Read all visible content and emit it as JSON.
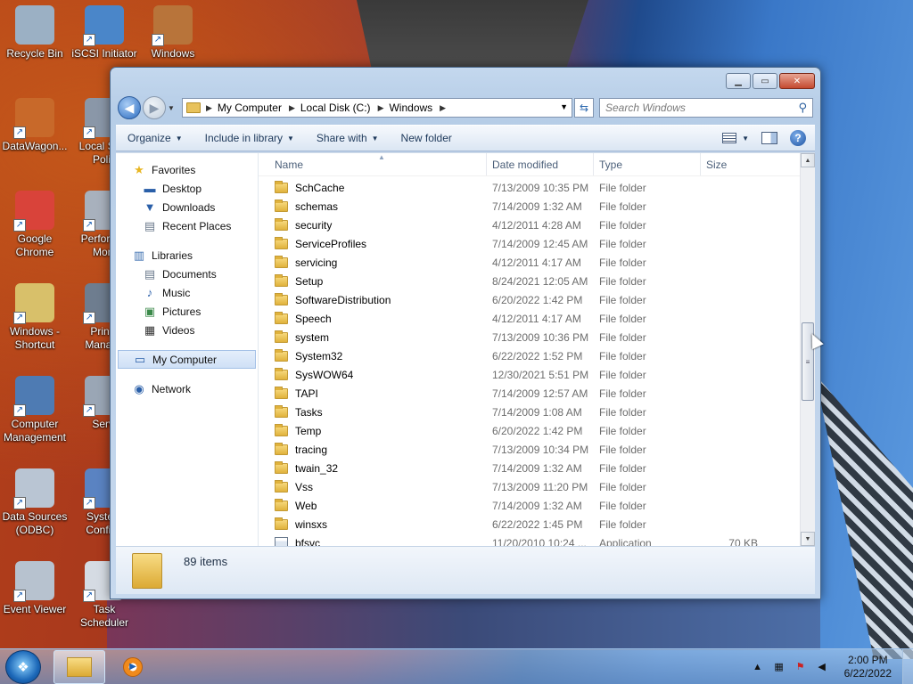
{
  "desktop": {
    "icons": [
      {
        "label": "Recycle Bin",
        "icon": "recycle-bin-icon"
      },
      {
        "label": "iSCSI Initiator",
        "icon": "iscsi-icon"
      },
      {
        "label": "Windows",
        "icon": "windows-icon"
      },
      {
        "label": "DataWagon...",
        "icon": "datawagon-icon"
      },
      {
        "label": "Local Se... Polic",
        "icon": "local-security-icon"
      },
      {
        "label": "Google Chrome",
        "icon": "chrome-icon"
      },
      {
        "label": "Perform... Moni",
        "icon": "performance-icon"
      },
      {
        "label": "Windows - Shortcut",
        "icon": "windows-shortcut-icon"
      },
      {
        "label": "Prin... Manage",
        "icon": "print-management-icon"
      },
      {
        "label": "Computer Management",
        "icon": "computer-management-icon"
      },
      {
        "label": "Servi",
        "icon": "services-icon"
      },
      {
        "label": "Data Sources (ODBC)",
        "icon": "odbc-icon"
      },
      {
        "label": "Syste... Configu",
        "icon": "system-config-icon"
      },
      {
        "label": "Event Viewer",
        "icon": "event-viewer-icon"
      },
      {
        "label": "Task Scheduler",
        "icon": "task-scheduler-icon"
      }
    ]
  },
  "window": {
    "address": {
      "segments": [
        "My Computer",
        "Local Disk (C:)",
        "Windows"
      ]
    },
    "search": {
      "placeholder": "Search Windows"
    },
    "toolbar": {
      "organize": "Organize",
      "include": "Include in library",
      "share": "Share with",
      "new_folder": "New folder"
    },
    "nav": {
      "favorites": "Favorites",
      "desktop": "Desktop",
      "downloads": "Downloads",
      "recent": "Recent Places",
      "libraries": "Libraries",
      "documents": "Documents",
      "music": "Music",
      "pictures": "Pictures",
      "videos": "Videos",
      "computer": "My Computer",
      "network": "Network"
    },
    "columns": {
      "name": "Name",
      "date": "Date modified",
      "type": "Type",
      "size": "Size"
    },
    "files": [
      {
        "name": "SchCache",
        "date": "7/13/2009 10:35 PM",
        "type": "File folder",
        "size": "",
        "kind": "folder"
      },
      {
        "name": "schemas",
        "date": "7/14/2009 1:32 AM",
        "type": "File folder",
        "size": "",
        "kind": "folder"
      },
      {
        "name": "security",
        "date": "4/12/2011 4:28 AM",
        "type": "File folder",
        "size": "",
        "kind": "folder"
      },
      {
        "name": "ServiceProfiles",
        "date": "7/14/2009 12:45 AM",
        "type": "File folder",
        "size": "",
        "kind": "folder"
      },
      {
        "name": "servicing",
        "date": "4/12/2011 4:17 AM",
        "type": "File folder",
        "size": "",
        "kind": "folder"
      },
      {
        "name": "Setup",
        "date": "8/24/2021 12:05 AM",
        "type": "File folder",
        "size": "",
        "kind": "folder"
      },
      {
        "name": "SoftwareDistribution",
        "date": "6/20/2022 1:42 PM",
        "type": "File folder",
        "size": "",
        "kind": "folder"
      },
      {
        "name": "Speech",
        "date": "4/12/2011 4:17 AM",
        "type": "File folder",
        "size": "",
        "kind": "folder"
      },
      {
        "name": "system",
        "date": "7/13/2009 10:36 PM",
        "type": "File folder",
        "size": "",
        "kind": "folder"
      },
      {
        "name": "System32",
        "date": "6/22/2022 1:52 PM",
        "type": "File folder",
        "size": "",
        "kind": "folder"
      },
      {
        "name": "SysWOW64",
        "date": "12/30/2021 5:51 PM",
        "type": "File folder",
        "size": "",
        "kind": "folder"
      },
      {
        "name": "TAPI",
        "date": "7/14/2009 12:57 AM",
        "type": "File folder",
        "size": "",
        "kind": "folder"
      },
      {
        "name": "Tasks",
        "date": "7/14/2009 1:08 AM",
        "type": "File folder",
        "size": "",
        "kind": "folder"
      },
      {
        "name": "Temp",
        "date": "6/20/2022 1:42 PM",
        "type": "File folder",
        "size": "",
        "kind": "folder"
      },
      {
        "name": "tracing",
        "date": "7/13/2009 10:34 PM",
        "type": "File folder",
        "size": "",
        "kind": "folder"
      },
      {
        "name": "twain_32",
        "date": "7/14/2009 1:32 AM",
        "type": "File folder",
        "size": "",
        "kind": "folder"
      },
      {
        "name": "Vss",
        "date": "7/13/2009 11:20 PM",
        "type": "File folder",
        "size": "",
        "kind": "folder"
      },
      {
        "name": "Web",
        "date": "7/14/2009 1:32 AM",
        "type": "File folder",
        "size": "",
        "kind": "folder"
      },
      {
        "name": "winsxs",
        "date": "6/22/2022 1:45 PM",
        "type": "File folder",
        "size": "",
        "kind": "folder"
      },
      {
        "name": "bfsvc",
        "date": "11/20/2010 10:24 ...",
        "type": "Application",
        "size": "70 KB",
        "kind": "app"
      }
    ],
    "status": {
      "items": "89 items"
    }
  },
  "taskbar": {
    "time": "2:00 PM",
    "date": "6/22/2022"
  }
}
